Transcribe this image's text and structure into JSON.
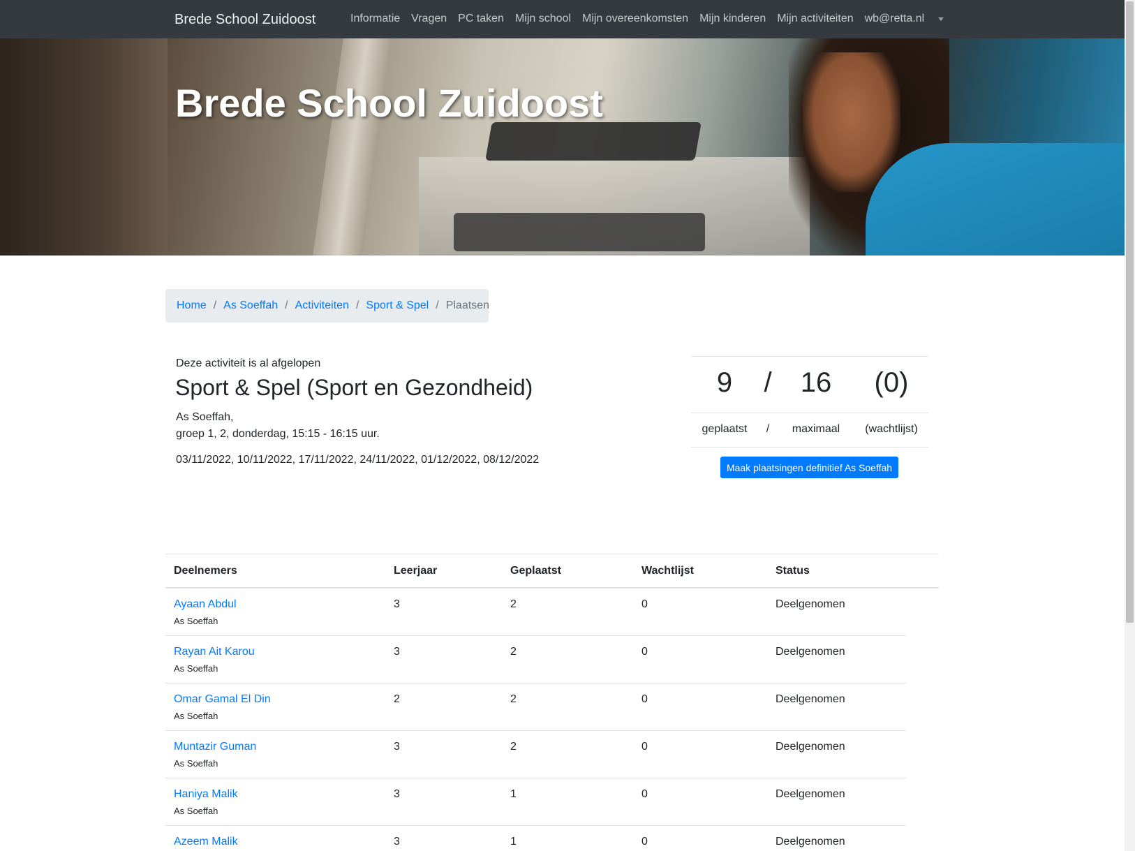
{
  "navbar": {
    "brand": "Brede School Zuidoost",
    "items": [
      "Informatie",
      "Vragen",
      "PC taken",
      "Mijn school",
      "Mijn overeenkomsten",
      "Mijn kinderen",
      "Mijn activiteiten",
      "wb@retta.nl"
    ],
    "background": "#343a40"
  },
  "hero": {
    "title": "Brede School Zuidoost"
  },
  "breadcrumb": {
    "items": [
      "Home",
      "As Soeffah",
      "Activiteiten",
      "Sport & Spel"
    ],
    "active": "Plaatsen",
    "separator": "/"
  },
  "activity": {
    "status_note": "Deze activiteit is al afgelopen",
    "title": "Sport & Spel (Sport en Gezondheid)",
    "location": "As Soeffah,",
    "schedule": "groep 1, 2, donderdag, 15:15 - 16:15 uur.",
    "dates": "03/11/2022, 10/11/2022, 17/11/2022, 24/11/2022, 01/12/2022, 08/12/2022"
  },
  "stats": {
    "placed": "9",
    "sep": "/",
    "max": "16",
    "waitlist": "(0)",
    "placed_label": "geplaatst",
    "max_label": "maximaal",
    "waitlist_label": "(wachtlijst)",
    "button_label": "Maak plaatsingen definitief As Soeffah"
  },
  "table": {
    "headers": [
      "Deelnemers",
      "Leerjaar",
      "Geplaatst",
      "Wachtlijst",
      "Status"
    ],
    "rows": [
      {
        "name": "Ayaan Abdul",
        "school": "As Soeffah",
        "leerjaar": "3",
        "geplaatst": "2",
        "wachtlijst": "0",
        "status": "Deelgenomen"
      },
      {
        "name": "Rayan Ait Karou",
        "school": "As Soeffah",
        "leerjaar": "3",
        "geplaatst": "2",
        "wachtlijst": "0",
        "status": "Deelgenomen"
      },
      {
        "name": "Omar Gamal El Din",
        "school": "As Soeffah",
        "leerjaar": "2",
        "geplaatst": "2",
        "wachtlijst": "0",
        "status": "Deelgenomen"
      },
      {
        "name": "Muntazir Guman",
        "school": "As Soeffah",
        "leerjaar": "3",
        "geplaatst": "2",
        "wachtlijst": "0",
        "status": "Deelgenomen"
      },
      {
        "name": "Haniya Malik",
        "school": "As Soeffah",
        "leerjaar": "3",
        "geplaatst": "1",
        "wachtlijst": "0",
        "status": "Deelgenomen"
      },
      {
        "name": "Azeem Malik",
        "school": "",
        "leerjaar": "3",
        "geplaatst": "1",
        "wachtlijst": "0",
        "status": "Deelgenomen"
      }
    ]
  },
  "colors": {
    "link": "#007bff",
    "primary_button": "#007bff",
    "breadcrumb_bg": "#e9ecef"
  }
}
